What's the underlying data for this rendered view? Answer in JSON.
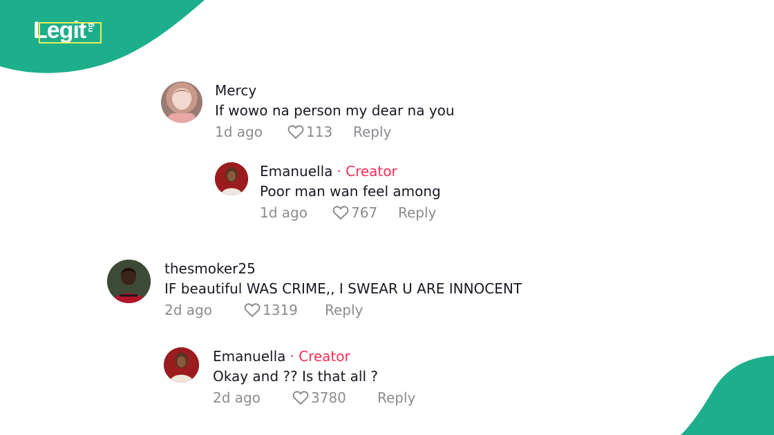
{
  "brand": {
    "logo_text": "Legit",
    "logo_suffix": "ng"
  },
  "colors": {
    "brand_green": "#1dae8b",
    "creator_red": "#fe2c55",
    "meta_gray": "#8a8b91"
  },
  "comments": [
    {
      "user": "Mercy",
      "text": "If wowo na person my dear na you",
      "time": "1d ago",
      "likes": "113",
      "reply": "Reply",
      "creator_tag": ""
    },
    {
      "user": "Emanuella",
      "creator_tag": "· Creator",
      "text": "Poor man wan feel among",
      "time": "1d ago",
      "likes": "767",
      "reply": "Reply"
    },
    {
      "user": "thesmoker25",
      "text": "IF beautiful WAS CRIME,, I SWEAR U ARE INNOCENT",
      "time": "2d ago",
      "likes": "1319",
      "reply": "Reply",
      "creator_tag": ""
    },
    {
      "user": "Emanuella",
      "creator_tag": "· Creator",
      "text": "Okay and ?? Is that all ?",
      "time": "2d ago",
      "likes": "3780",
      "reply": "Reply"
    }
  ]
}
